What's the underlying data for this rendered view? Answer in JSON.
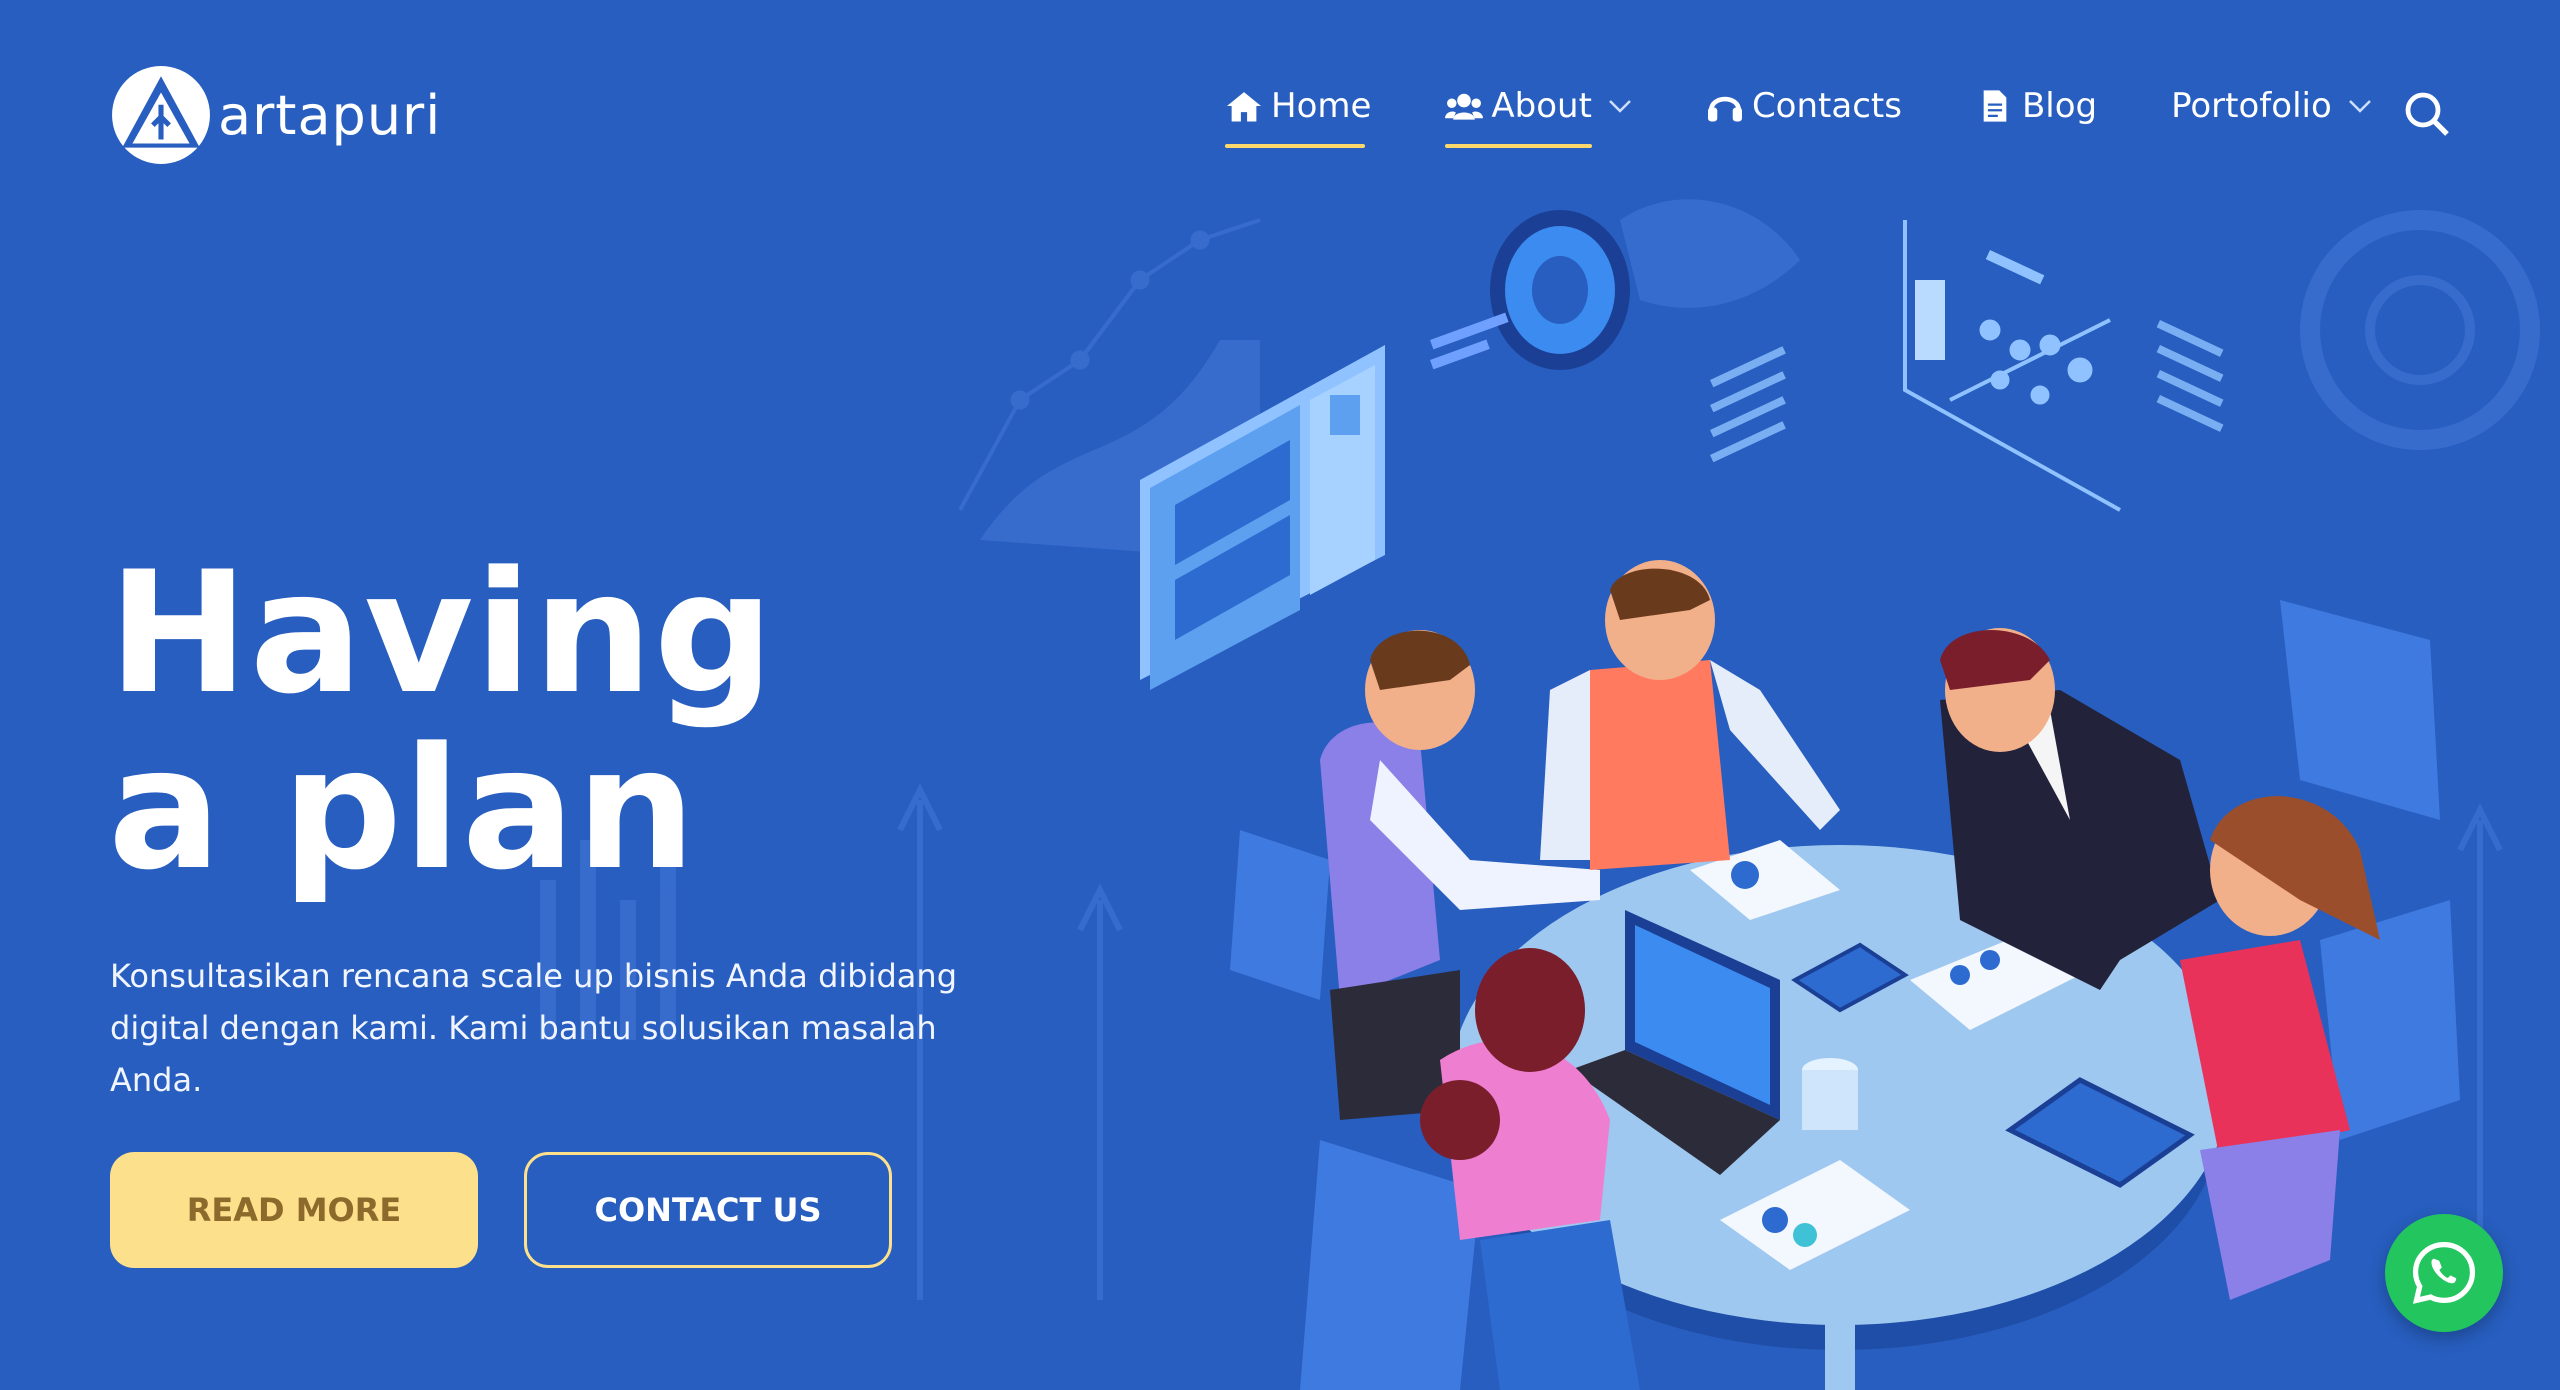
{
  "brand": {
    "name": "artapuri"
  },
  "nav": {
    "home": "Home",
    "about": "About",
    "contacts": "Contacts",
    "blog": "Blog",
    "portfolio": "Portofolio"
  },
  "hero": {
    "title": "Having a plan",
    "subtitle": "Konsultasikan rencana scale up bisnis Anda dibidang digital dengan kami. Kami bantu solusikan masalah Anda.",
    "read_more": "READ MORE",
    "contact_us": "CONTACT US"
  },
  "colors": {
    "background": "#275ebf",
    "accent": "#fde08b",
    "whatsapp": "#23c65e"
  },
  "icons": [
    "home-icon",
    "users-icon",
    "headphones-icon",
    "document-icon",
    "chevron-down-icon",
    "search-icon",
    "whatsapp-icon"
  ]
}
